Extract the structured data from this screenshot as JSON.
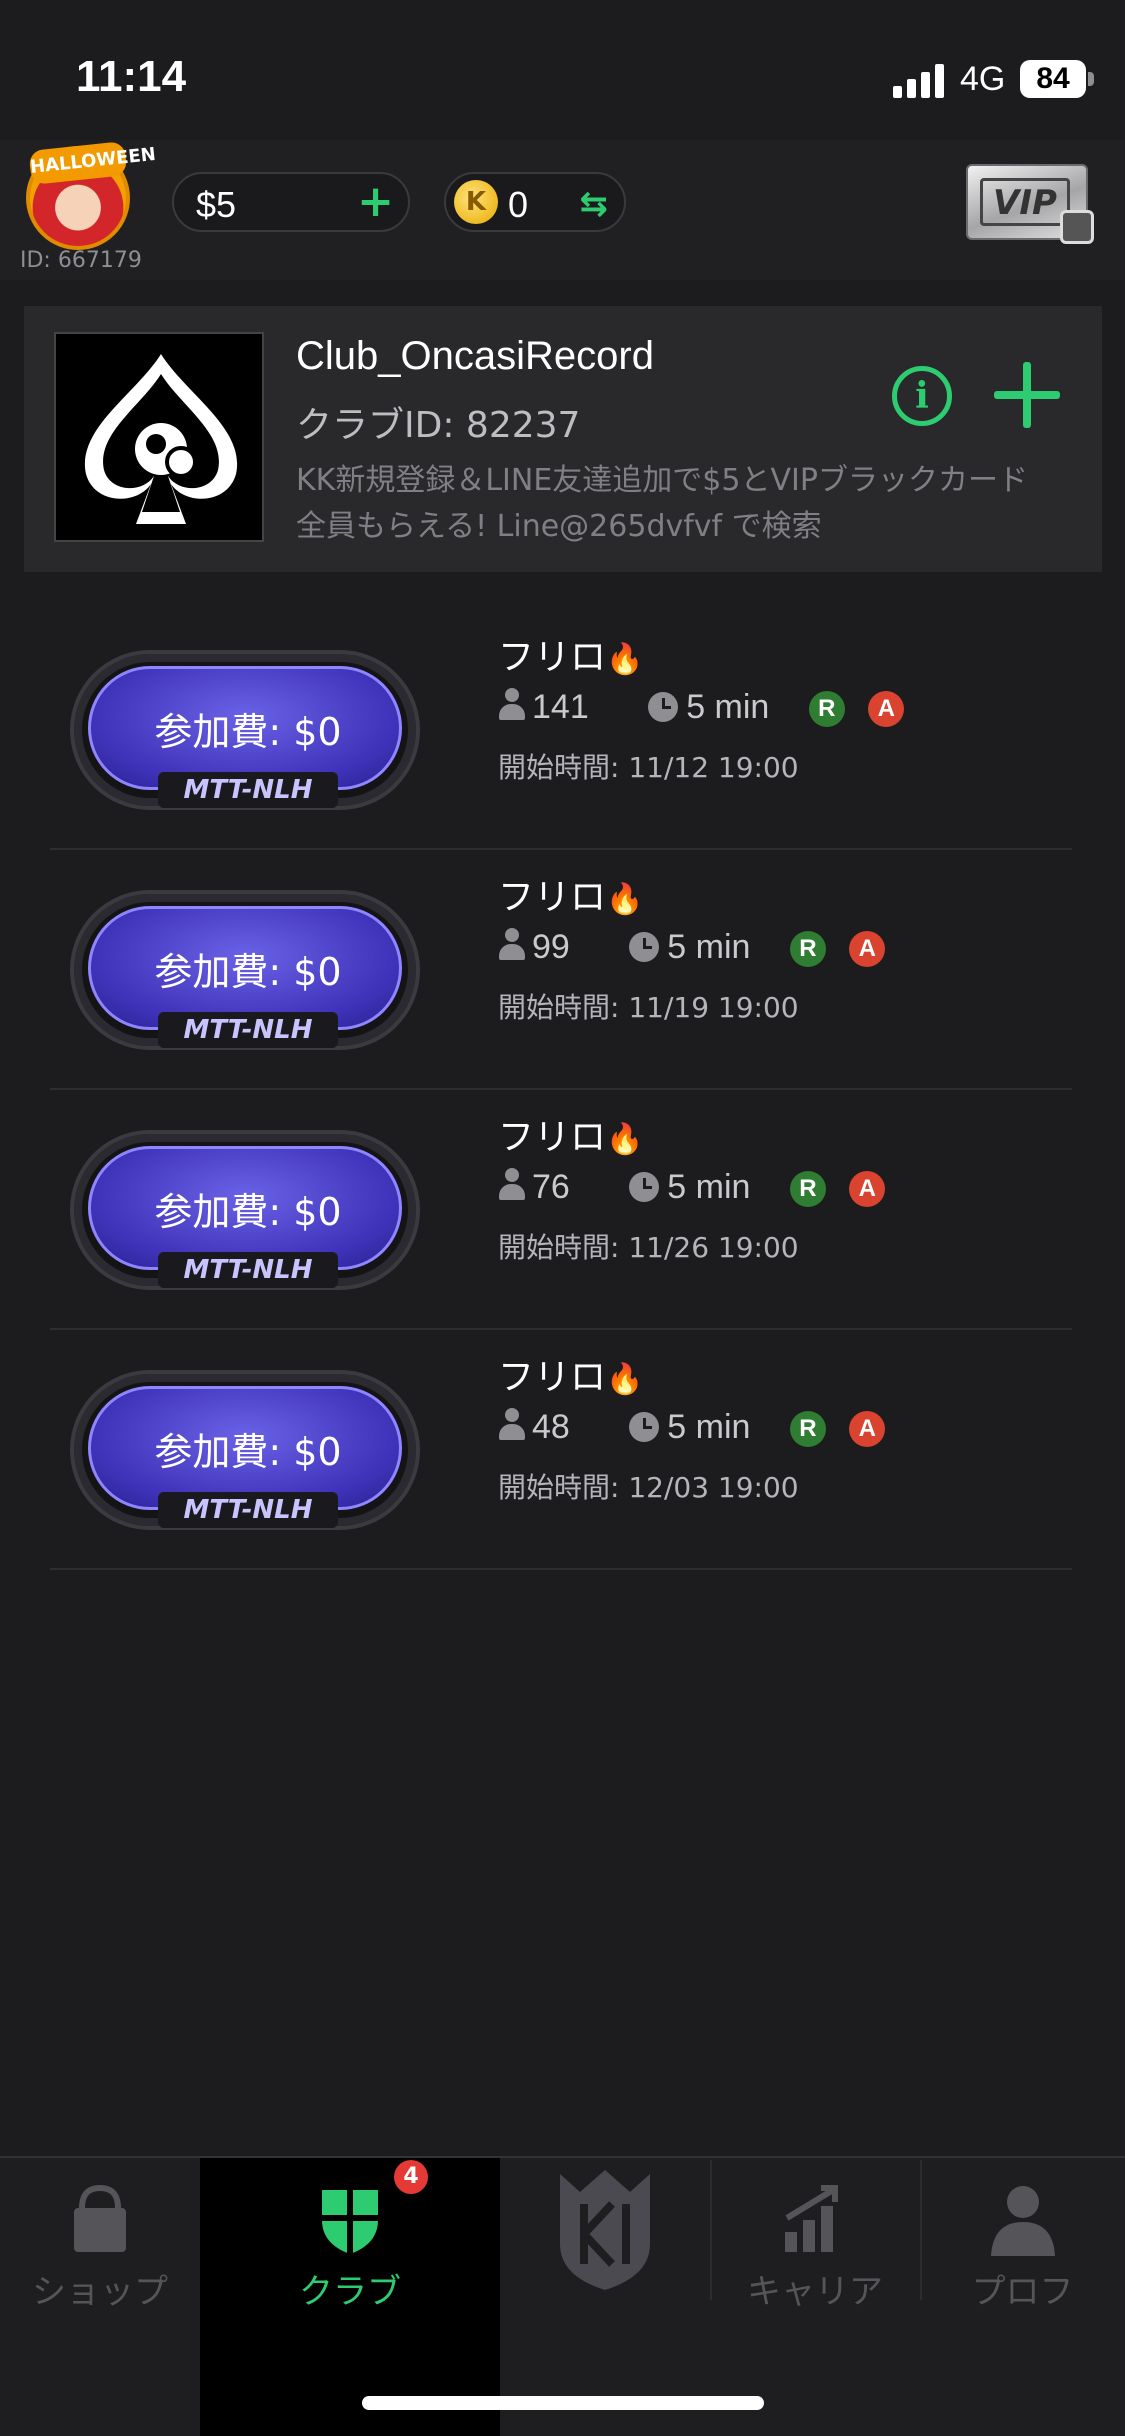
{
  "status_bar": {
    "time": "11:14",
    "network": "4G",
    "battery": "84"
  },
  "header": {
    "avatar_tag": "HALLOWEEN",
    "user_id": "ID: 667179",
    "cash": "$5",
    "coins": "0",
    "coin_letter": "K",
    "vip_label": "VIP"
  },
  "club": {
    "name": "Club_OncasiRecord",
    "id": "クラブID: 82237",
    "description": "KK新規登録＆LINE友達追加で$5とVIPブラックカード全員もらえる! Line@265dvfvf で検索"
  },
  "tournaments": [
    {
      "fee": "参加費: $0",
      "type": "MTT-NLH",
      "name": "フリロ",
      "players": "141",
      "blind": "5 min",
      "badge_r": "R",
      "badge_a": "A",
      "start": "開始時間: 11/12 19:00"
    },
    {
      "fee": "参加費: $0",
      "type": "MTT-NLH",
      "name": "フリロ",
      "players": "99",
      "blind": "5 min",
      "badge_r": "R",
      "badge_a": "A",
      "start": "開始時間: 11/19 19:00"
    },
    {
      "fee": "参加費: $0",
      "type": "MTT-NLH",
      "name": "フリロ",
      "players": "76",
      "blind": "5 min",
      "badge_r": "R",
      "badge_a": "A",
      "start": "開始時間: 11/26 19:00"
    },
    {
      "fee": "参加費: $0",
      "type": "MTT-NLH",
      "name": "フリロ",
      "players": "48",
      "blind": "5 min",
      "badge_r": "R",
      "badge_a": "A",
      "start": "開始時間: 12/03 19:00"
    }
  ],
  "tabbar": {
    "shop": "ショップ",
    "club": "クラブ",
    "club_badge": "4",
    "career": "キャリア",
    "profile": "プロフ"
  },
  "colors": {
    "accent": "#2ecc71",
    "background": "#1c1c1e",
    "felt": "#4a3fd0",
    "danger": "#e53935"
  }
}
